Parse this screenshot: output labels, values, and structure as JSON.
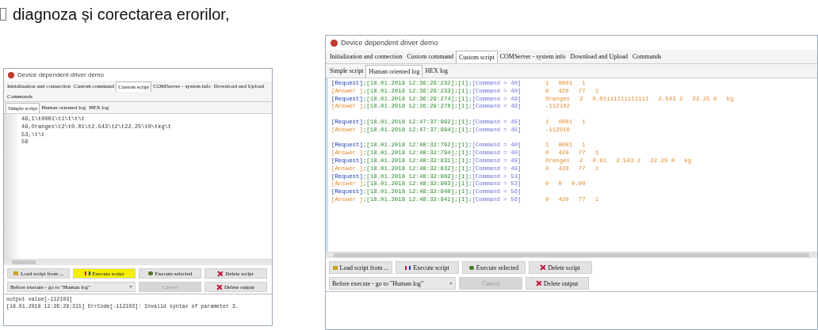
{
  "doc_text": "diagnoza și corectarea erorilor,",
  "windows": [
    {
      "title": "Device dependent driver demo",
      "tabs": [
        {
          "label": "Initialization and connection",
          "selected": false
        },
        {
          "label": "Custom command",
          "selected": false
        },
        {
          "label": "Custom script",
          "selected": true
        },
        {
          "label": "COMServer - system info",
          "selected": false
        },
        {
          "label": "Download and Upload",
          "selected": false
        },
        {
          "label": "Commands",
          "selected": false
        }
      ],
      "subtabs": [
        {
          "label": "Simple script",
          "selected": true
        },
        {
          "label": "Human oriented log",
          "selected": false
        },
        {
          "label": "HEX log",
          "selected": false
        }
      ],
      "content": {
        "kind": "script",
        "lines": [
          "48,1\\t0001\\t1\\t\\t\\t",
          "49,Oranges\\t2\\t0.01\\t2.543\\t2\\t22.25\\t0\\tkg\\t",
          "53,\\t\\t",
          "56"
        ]
      },
      "buttons": [
        {
          "label": "Load script from ...",
          "kind": "load",
          "highlighted": false,
          "disabled": false
        },
        {
          "label": "Execute script",
          "kind": "execute",
          "highlighted": true,
          "disabled": false
        },
        {
          "label": "Execute selected",
          "kind": "execute-selected",
          "highlighted": false,
          "disabled": false
        },
        {
          "label": "Delete script",
          "kind": "delete",
          "highlighted": false,
          "disabled": false
        }
      ],
      "dropdown": {
        "value": "Before execute - go to \"Human log\""
      },
      "buttons_row2": [
        {
          "label": "Cancel",
          "kind": "cancel",
          "highlighted": false,
          "disabled": true
        },
        {
          "label": "Delete output",
          "kind": "delete",
          "highlighted": false,
          "disabled": false
        }
      ],
      "output": [
        "output value[-112103]",
        "[18.01.2018 12:36:29:315] ErrCode[-112103]: Invalid syntax of parameter 3."
      ]
    },
    {
      "title": "Device dependent driver demo",
      "tabs": [
        {
          "label": "Initialization and connection",
          "selected": false
        },
        {
          "label": "Custom command",
          "selected": false
        },
        {
          "label": "Custom script",
          "selected": true
        },
        {
          "label": "COMServer - system info",
          "selected": false
        },
        {
          "label": "Download and Upload",
          "selected": false
        },
        {
          "label": "Commands",
          "selected": false
        }
      ],
      "subtabs": [
        {
          "label": "Simple script",
          "selected": false
        },
        {
          "label": "Human oriented log",
          "selected": true
        },
        {
          "label": "HEX log",
          "selected": false
        }
      ],
      "content": {
        "kind": "log",
        "rows": [
          {
            "kind": "request",
            "tag": "[Request]",
            "time": ";[18.01.2018 12:36:29:232];[1];",
            "command": "[Command = 40]",
            "values": [
              "1",
              "0001",
              "1"
            ]
          },
          {
            "kind": "answer",
            "tag": "[Answer ]",
            "time": ";[18.01.2018 12:36:29:233];[1];",
            "command": "[Command = 40]",
            "values": [
              "0",
              "420",
              "77",
              "1"
            ]
          },
          {
            "kind": "request",
            "tag": "[Request]",
            "time": ";[18.01.2018 12:36:29:274];[1];",
            "command": "[Command = 49]",
            "values": [
              "Oranges",
              "2",
              "0.01111111111111",
              "2.543 2",
              "22.25 0",
              "kg"
            ]
          },
          {
            "kind": "answer",
            "tag": "[Answer ]",
            "time": ";[18.01.2018 12:36:29:278];[1];",
            "command": "[Command = 49]",
            "values": [
              "-112102"
            ]
          },
          {
            "kind": "blank"
          },
          {
            "kind": "request",
            "tag": "[Request]",
            "time": ";[18.01.2018 12:47:37:992];[1];",
            "command": "[Command = 45]",
            "values": [
              "1",
              "0001",
              "1"
            ]
          },
          {
            "kind": "answer",
            "tag": "[Answer ]",
            "time": ";[18.01.2018 12:47:37:994];[1];",
            "command": "[Command = 45]",
            "values": [
              "-112010"
            ]
          },
          {
            "kind": "blank"
          },
          {
            "kind": "request",
            "tag": "[Request]",
            "time": ";[18.01.2018 12:48:32:792];[1];",
            "command": "[Command = 40]",
            "values": [
              "1",
              "0001",
              "1"
            ]
          },
          {
            "kind": "answer",
            "tag": "[Answer ]",
            "time": ";[18.01.2018 12:48:32:794];[1];",
            "command": "[Command = 40]",
            "values": [
              "0",
              "420",
              "77",
              "1"
            ]
          },
          {
            "kind": "request",
            "tag": "[Request]",
            "time": ";[18.01.2018 12:48:32:831];[1];",
            "command": "[Command = 49]",
            "values": [
              "Oranges",
              "2",
              "0.01",
              "2.543 2",
              "22.25 0",
              "kg"
            ]
          },
          {
            "kind": "answer",
            "tag": "[Answer ]",
            "time": ";[18.01.2018 12:48:32:832];[1];",
            "command": "[Command = 49]",
            "values": [
              "0",
              "420",
              "77",
              "1"
            ]
          },
          {
            "kind": "request",
            "tag": "[Request]",
            "time": ";[18.01.2018 12:48:32:902];[1];",
            "command": "[Command = 53]",
            "values": []
          },
          {
            "kind": "answer",
            "tag": "[Answer ]",
            "time": ";[18.01.2018 12:48:32:903];[1];",
            "command": "[Command = 53]",
            "values": [
              "0",
              "0",
              "0.00"
            ]
          },
          {
            "kind": "request",
            "tag": "[Request]",
            "time": ";[18.01.2018 12:48:32:940];[1];",
            "command": "[Command = 56]",
            "values": []
          },
          {
            "kind": "answer",
            "tag": "[Answer ]",
            "time": ";[18.01.2018 12:48:32:941];[1];",
            "command": "[Command = 56]",
            "values": [
              "0",
              "420",
              "77",
              "1"
            ]
          }
        ]
      },
      "buttons": [
        {
          "label": "Load script from ...",
          "kind": "load",
          "highlighted": false,
          "disabled": false
        },
        {
          "label": "Execute script",
          "kind": "execute",
          "highlighted": false,
          "disabled": false
        },
        {
          "label": "Execute selected",
          "kind": "execute-selected",
          "highlighted": false,
          "disabled": false
        },
        {
          "label": "Delete script",
          "kind": "delete",
          "highlighted": false,
          "disabled": false
        }
      ],
      "dropdown": {
        "value": "Before execute - go to \"Human log\""
      },
      "buttons_row2": [
        {
          "label": "Cancel",
          "kind": "cancel",
          "highlighted": false,
          "disabled": true
        },
        {
          "label": "Delete output",
          "kind": "delete",
          "highlighted": false,
          "disabled": false
        }
      ]
    }
  ]
}
